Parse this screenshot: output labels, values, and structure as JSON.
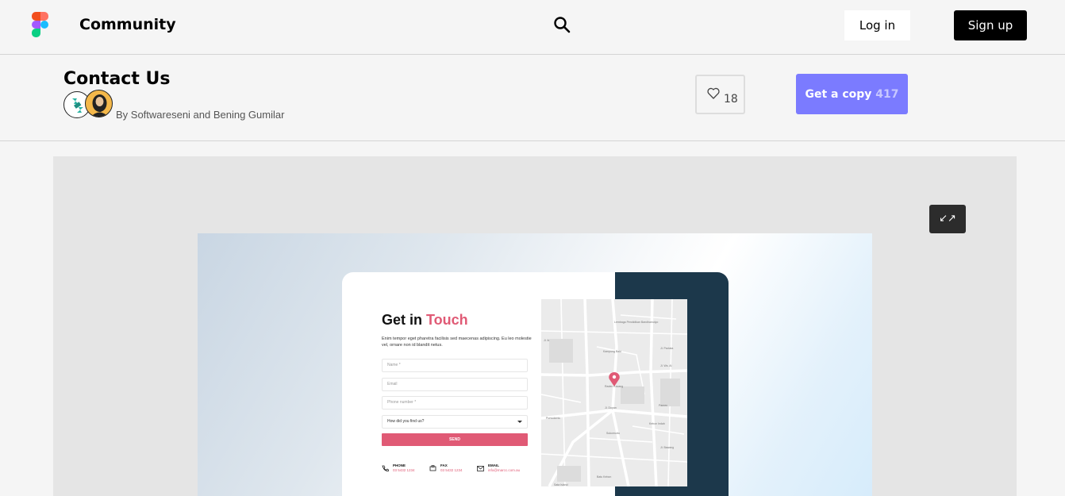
{
  "nav": {
    "brand": "Community",
    "login_label": "Log in",
    "signup_label": "Sign up"
  },
  "file": {
    "title": "Contact Us",
    "byline": "By Softwareseni and Bening Gumilar",
    "likes": "18",
    "copy_label": "Get a copy",
    "copy_count": "417"
  },
  "preview": {
    "expand_icon": "↙↗",
    "heading_start": "Get in ",
    "heading_accent": "Touch",
    "description": "Enim tempor eget pharetra facilisis sed maecenas adipiscing. Eu leo molestie vel, ornare non id blandit netus.",
    "fields": {
      "name_placeholder": "Name *",
      "email_placeholder": "Email",
      "phone_placeholder": "Phone number *",
      "source_value": "How did you find us?"
    },
    "send_label": "SEND",
    "contacts": [
      {
        "label": "PHONE",
        "value": "03 5432 1234"
      },
      {
        "label": "FAX",
        "value": "03 5432 1234"
      },
      {
        "label": "EMAIL",
        "value": "info@marcc.com.au"
      }
    ],
    "map_labels": {
      "top": "Lembaga Pendidikan Bandhamulyo",
      "mid": "Kampung Baki",
      "pin": "Raden Kacang",
      "left1": "Jl. Ik",
      "right1": "Jl. Ws. Al",
      "right2": "Jl. Paduka",
      "left2": "Purwokerto",
      "right3": "Pamen",
      "left3": "Jl. Dopan",
      "right4": "Kebon Indah",
      "left4": "Sukomurtu",
      "right5": "Jl. Bawang",
      "bottom": "Batu Kebon",
      "bottom2": "Sata Island"
    }
  },
  "colors": {
    "accent": "#e05a75",
    "copy_button": "#7b7bff",
    "dark_panel": "#1c384b"
  }
}
